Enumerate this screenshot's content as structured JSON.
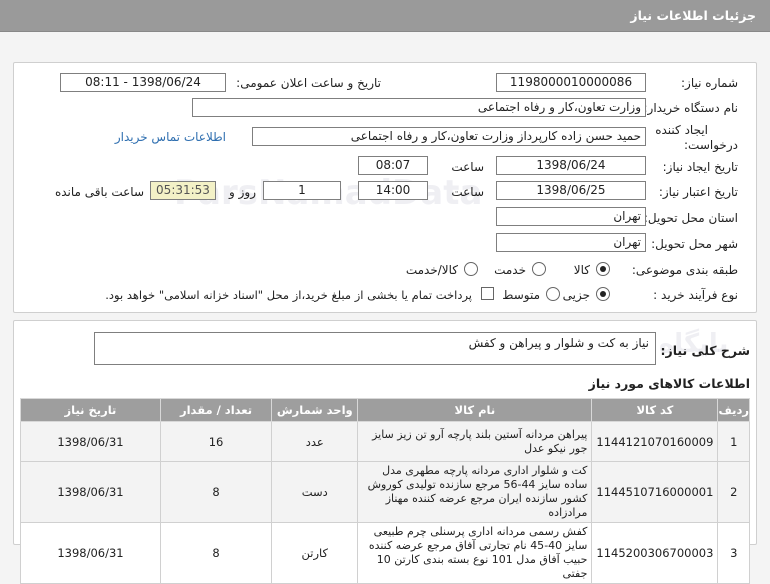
{
  "header": {
    "title": "جزئیات اطلاعات نیاز"
  },
  "form": {
    "need_number_label": "شماره نیاز:",
    "need_number_value": "1198000010000086",
    "announce_label": "تاریخ و ساعت اعلان عمومی:",
    "announce_value": "1398/06/24 - 08:11",
    "buyer_org_label": "نام دستگاه خریدار:",
    "buyer_org_value": "وزارت تعاون،کار و رفاه اجتماعی",
    "creator_label_1": "ایجاد کننده",
    "creator_label_2": "درخواست:",
    "creator_value": "حمید  حسن زاده کارپرداز وزارت تعاون،کار و رفاه اجتماعی",
    "contact_link": "اطلاعات تماس خریدار",
    "need_date_label": "تاریخ ایجاد نیاز:",
    "need_date_value": "1398/06/24",
    "time_label": "ساعت",
    "need_time_value": "08:07",
    "validity_label": "تاریخ اعتبار نیاز:",
    "validity_date_value": "1398/06/25",
    "validity_time_value": "14:00",
    "days_value": "1",
    "day_and_label": "روز و",
    "remaining_value": "05:31:53",
    "remaining_label": "ساعت باقی مانده",
    "province_label": "استان محل تحویل:",
    "province_value": "تهران",
    "city_label": "شهر محل تحویل:",
    "city_value": "تهران",
    "category_label": "طبقه بندی موضوعی:",
    "category_options": [
      "کالا",
      "خدمت",
      "کالا/خدمت"
    ],
    "process_label": "نوع فرآیند خرید :",
    "process_options": [
      "جزیی",
      "متوسط"
    ],
    "payment_note": "پرداخت تمام یا بخشی از مبلغ خرید،از محل \"اسناد خزانه اسلامی\" خواهد بود."
  },
  "description": {
    "label": "شرح کلی نیاز:",
    "value": "نیاز به کت و شلوار و پیراهن و کفش"
  },
  "items_title": "اطلاعات کالاهای مورد نیاز",
  "table": {
    "headers": [
      "ردیف",
      "کد کالا",
      "نام کالا",
      "واحد شمارش",
      "تعداد / مقدار",
      "تاریخ نیاز"
    ],
    "rows": [
      {
        "row": "1",
        "code": "1144121070160009",
        "name": "پیراهن مردانه آستین بلند پارچه آرو تن زیز سایز جور نیکو عدل",
        "unit": "عدد",
        "qty": "16",
        "date": "1398/06/31"
      },
      {
        "row": "2",
        "code": "1144510716000001",
        "name": "کت و شلوار اداری مردانه پارچه مطهری مدل ساده سایز 44-56 مرجع سازنده تولیدی کوروش کشور سازنده ایران مرجع عرضه کننده مهناز مرادزاده",
        "unit": "دست",
        "qty": "8",
        "date": "1398/06/31"
      },
      {
        "row": "3",
        "code": "1145200306700003",
        "name": "کفش رسمی مردانه اداری پرسنلی چرم طبیعی سایز 40-45 نام تجارتی آفاق مرجع عرضه کننده حبیب آفاق مدل 101 نوع بسته بندی کارتن 10 جفتی",
        "unit": "کارتن",
        "qty": "8",
        "date": "1398/06/31"
      }
    ]
  }
}
